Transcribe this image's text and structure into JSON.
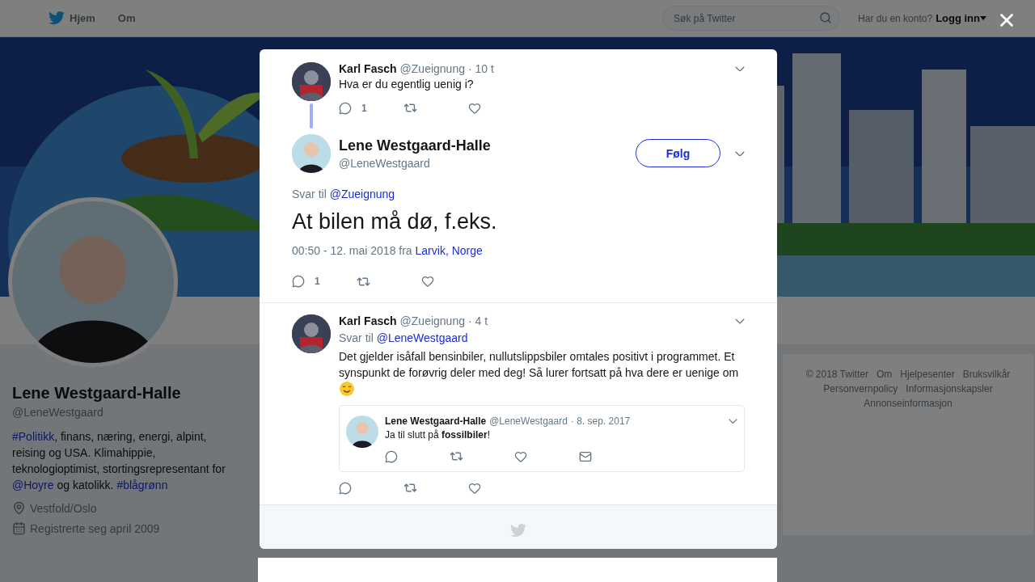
{
  "topbar": {
    "nav": [
      {
        "label": "Hjem",
        "kind": "home"
      },
      {
        "label": "Om",
        "kind": "plain"
      }
    ],
    "search": {
      "placeholder": "Søk på Twitter"
    },
    "login": {
      "prompt": "Har du en konto?",
      "link": "Logg inn"
    }
  },
  "profile": {
    "name": "Lene Westgaard-Halle",
    "handle": "@LeneWestgaard",
    "bio": [
      {
        "kind": "link",
        "text": "#Politikk"
      },
      {
        "kind": "text",
        "text": ", finans, næring, energi, alpint, reising og USA. Klimahippie, teknologioptimist, stortingsrepresentant for "
      },
      {
        "kind": "link",
        "text": "@Hoyre"
      },
      {
        "kind": "text",
        "text": " og katolikk. "
      },
      {
        "kind": "link",
        "text": "#blågrønn"
      }
    ],
    "location": "Vestfold/Oslo",
    "joined": "Registrerte seg april 2009"
  },
  "footer": {
    "links": [
      "© 2018 Twitter",
      "Om",
      "Hjelpesenter",
      "Bruksvilkår",
      "Personvernpolicy",
      "Informasjonskapsler",
      "Annonseinformasjon"
    ]
  },
  "dialog": {
    "parent_tweet": {
      "name": "Karl Fasch",
      "handle": "@Zueignung",
      "time": "· 10 t",
      "text": "Hva er du egentlig uenig i?",
      "reply_count": "1"
    },
    "main_tweet": {
      "name": "Lene Westgaard-Halle",
      "handle": "@LeneWestgaard",
      "follow": "Følg",
      "reply_prefix": "Svar til",
      "reply_to": "@Zueignung",
      "text": "At bilen må dø, f.eks.",
      "meta": "00:50 - 12. mai 2018 fra",
      "place": "Larvik, Norge",
      "reply_count": "1"
    },
    "replies": [
      {
        "name": "Karl Fasch",
        "handle": "@Zueignung",
        "time": "· 4 t",
        "reply_prefix": "Svar til",
        "reply_to": "@LeneWestgaard",
        "text": "Det gjelder isåfall bensinbiler, nullutslippsbiler omtales positivt i programmet. Et synspunkt de forøvrig deler med deg! Så lurer fortsatt på hva dere er uenige om",
        "emoji": true,
        "quote": {
          "name": "Lene Westgaard-Halle",
          "handle": "@LeneWestgaard",
          "time": "· 8. sep. 2017",
          "text": "Ja til slutt på **fossilbiler**!"
        }
      }
    ]
  }
}
